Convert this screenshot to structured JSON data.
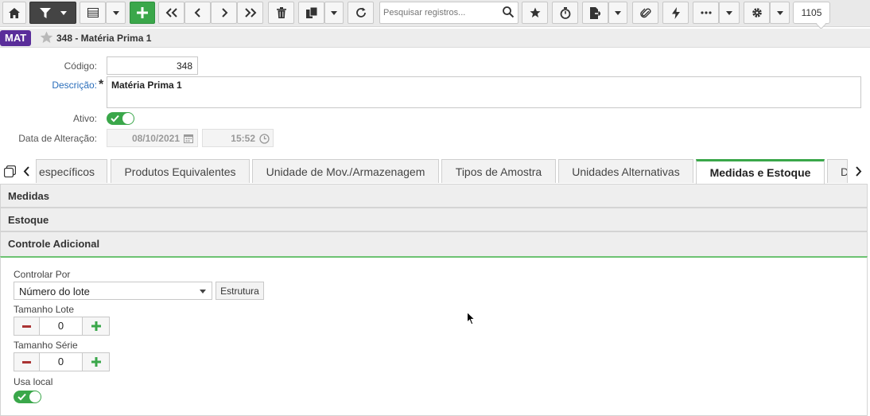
{
  "toolbar": {
    "search_placeholder": "Pesquisar registros...",
    "record_count": "1105"
  },
  "header": {
    "badge": "MAT",
    "title": "348 - Matéria Prima 1"
  },
  "form": {
    "codigo_label": "Código:",
    "codigo_value": "348",
    "descricao_label": "Descrição:",
    "descricao_value": "Matéria Prima 1",
    "ativo_label": "Ativo:",
    "data_label": "Data de Alteração:",
    "data_value": "08/10/2021",
    "hora_value": "15:52"
  },
  "tabs": [
    {
      "label": "específicos"
    },
    {
      "label": "Produtos Equivalentes"
    },
    {
      "label": "Unidade de Mov./Armazenagem"
    },
    {
      "label": "Tipos de Amostra"
    },
    {
      "label": "Unidades Alternativas"
    },
    {
      "label": "Medidas e Estoque"
    },
    {
      "label": "D"
    }
  ],
  "sections": {
    "medidas": "Medidas",
    "estoque": "Estoque",
    "controle": "Controle Adicional"
  },
  "controle": {
    "controlar_por_label": "Controlar Por",
    "controlar_por_value": "Número do lote",
    "estrutura_label": "Estrutura",
    "tamanho_lote_label": "Tamanho Lote",
    "tamanho_lote_value": "0",
    "tamanho_serie_label": "Tamanho Série",
    "tamanho_serie_value": "0",
    "usa_local_label": "Usa local"
  },
  "colors": {
    "accent": "#3aa74a",
    "badge": "#5a2d9a",
    "link": "#2a6ebb"
  }
}
